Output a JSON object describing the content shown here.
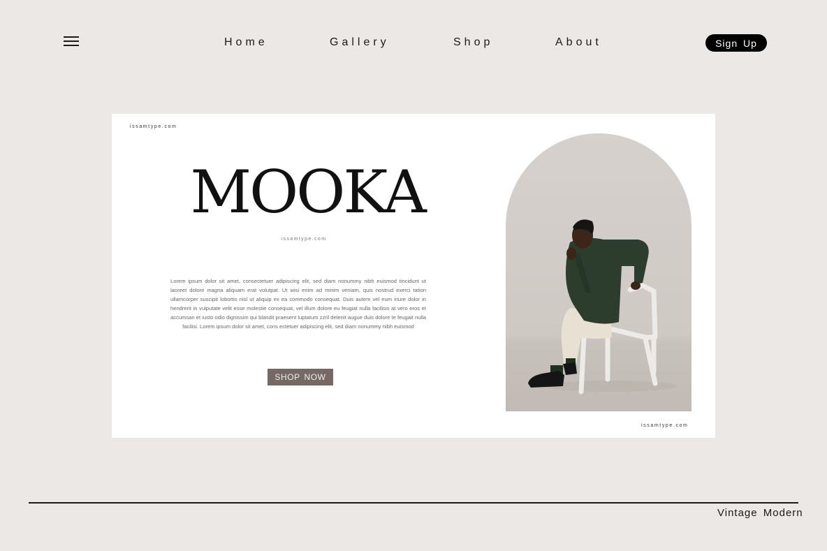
{
  "nav": {
    "menu_icon": "hamburger-menu-icon",
    "links": [
      "Home",
      "Gallery",
      "Shop",
      "About"
    ],
    "signup_label": "Sign Up"
  },
  "hero": {
    "site_url_top": "issamtype.com",
    "brand": "MOOKA",
    "brand_sub": "issamtype.com",
    "body_text": "Lorem ipsum dolor sit amet, consectetuer adipiscing elit, sed diam nonummy nibh euismod tincidunt ut laoreet dolore magna aliquam erat volutpat. Ut wisi enim ad minim veniam, quis nostrud exerci tation ullamcorper suscipit lobortis nisl ut aliquip ex ea commodo consequat. Duis autem vel eum iriure dolor in hendrerit in vulputate velit esse molestie consequat, vel illum dolore eu feugiat nulla facilisis at vero eros et accumsan et iusto odio dignissim qui blandit praesent luptatum zzril delenit augue duis dolore te feugait nulla facilisi. Lorem ipsum dolor sit amet, cons ectetuer adipiscing elit, sed diam nonummy nibh euismod",
    "shop_label": "SHOP NOW",
    "site_url_bottom": "issamtype.com"
  },
  "footer": {
    "tagline": "Vintage Modern"
  },
  "colors": {
    "page_bg": "#ece8e5",
    "card_bg": "#ffffff",
    "shop_button": "#756865",
    "signup_button": "#000000",
    "jacket_green": "#2c3d2e"
  }
}
